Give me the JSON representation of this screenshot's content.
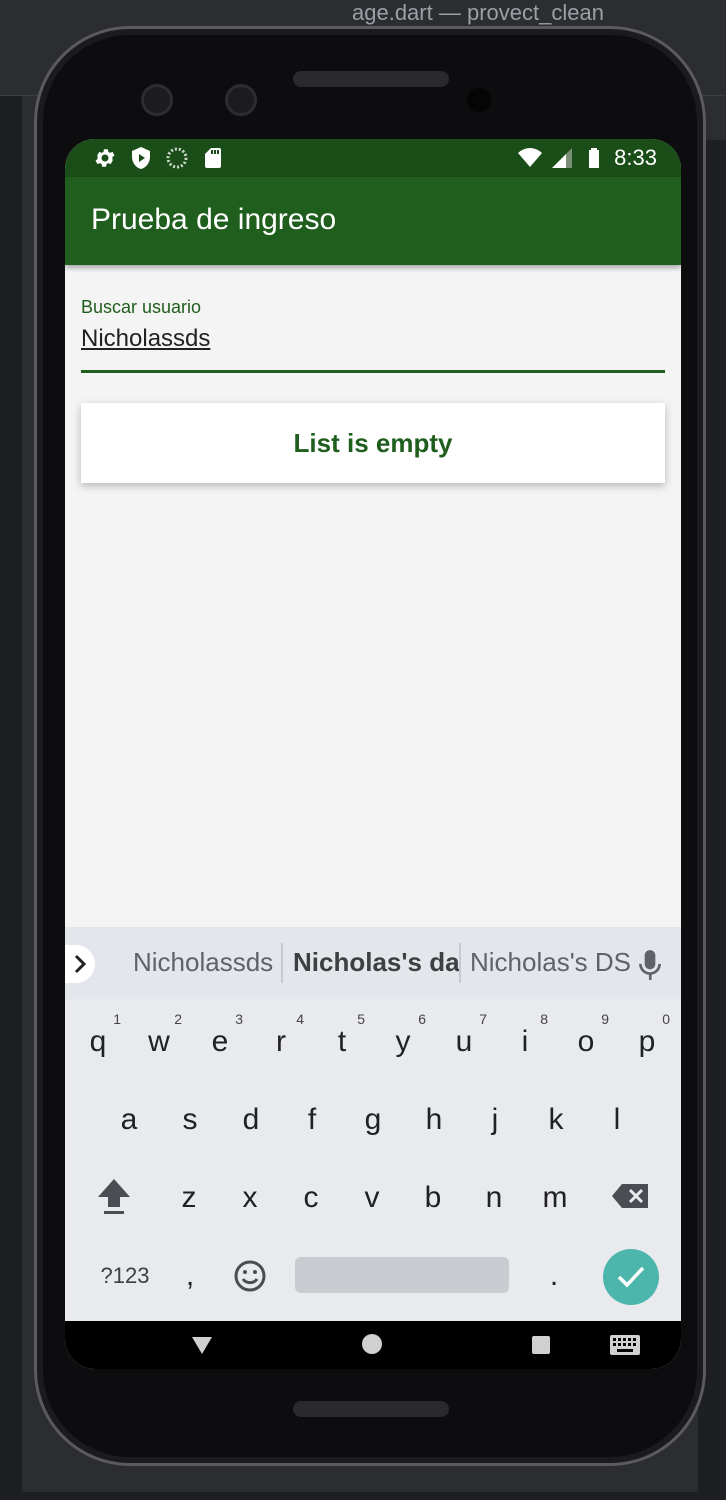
{
  "ide": {
    "title_fragment": "age.dart — provect_clean"
  },
  "status_bar": {
    "time": "8:33",
    "left_icons": [
      "settings-icon",
      "shield-play-icon",
      "loading-circle-icon",
      "sd-card-icon"
    ],
    "right_icons": [
      "wifi-icon",
      "signal-icon",
      "battery-icon"
    ]
  },
  "app_bar": {
    "title": "Prueba de ingreso"
  },
  "search": {
    "label": "Buscar usuario",
    "value": "Nicholassds"
  },
  "empty_state": {
    "text": "List is empty"
  },
  "keyboard": {
    "suggestions": [
      "Nicholassds",
      "Nicholas's da",
      "Nicholas's DS"
    ],
    "row1": [
      {
        "k": "q",
        "n": "1"
      },
      {
        "k": "w",
        "n": "2"
      },
      {
        "k": "e",
        "n": "3"
      },
      {
        "k": "r",
        "n": "4"
      },
      {
        "k": "t",
        "n": "5"
      },
      {
        "k": "y",
        "n": "6"
      },
      {
        "k": "u",
        "n": "7"
      },
      {
        "k": "i",
        "n": "8"
      },
      {
        "k": "o",
        "n": "9"
      },
      {
        "k": "p",
        "n": "0"
      }
    ],
    "row2": [
      "a",
      "s",
      "d",
      "f",
      "g",
      "h",
      "j",
      "k",
      "l"
    ],
    "row3": [
      "z",
      "x",
      "c",
      "v",
      "b",
      "n",
      "m"
    ],
    "symbols_label": "?123",
    "comma": ",",
    "period": "."
  },
  "colors": {
    "app_bar": "#1f5e1d",
    "status_bar": "#1a4d17",
    "accent": "#4db6ac"
  }
}
